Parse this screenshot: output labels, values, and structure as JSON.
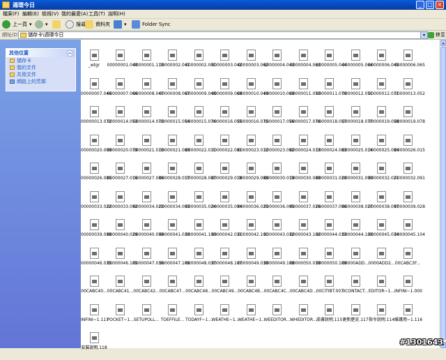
{
  "window": {
    "title": "週環今日"
  },
  "menu": [
    "檔案(F)",
    "編輯(E)",
    "檢視(V)",
    "我的最愛(A)",
    "工具(T)",
    "說明(H)"
  ],
  "toolbar": {
    "back": "上一頁",
    "search": "搜尋",
    "folders": "資料夾",
    "folder_sync": "Folder Sync"
  },
  "address": {
    "label": "網址(D)",
    "value": "儲存卡\\週環今日",
    "go": "移至"
  },
  "tasks": {
    "header": "其他位置",
    "items": [
      "儲存卡",
      "我的文件",
      "共用文件",
      "網路上的芳鄰"
    ]
  },
  "files": [
    "_wtgr",
    "00000001.040",
    "00000001.110",
    "00000002.041",
    "00000002.001",
    "00000003.042",
    "00000003.062",
    "00000004.043",
    "00000004.063",
    "00000005.044",
    "00000005.064",
    "00000006.045",
    "00000006.065",
    "00000007.046",
    "00000007.066",
    "00000008.047",
    "00000008.067",
    "00000009.048",
    "00000009.068",
    "00000010.049",
    "00000010.069",
    "00000011.050",
    "00000011.070",
    "00000012.051",
    "00000012.071",
    "00000013.052",
    "00000013.072",
    "00000014.053",
    "00000014.073",
    "00000015.054",
    "00000015.074",
    "00000016.055",
    "00000016.075",
    "00000017.056",
    "00000017.076",
    "00000018.057",
    "00000018.077",
    "00000019.058",
    "00000019.078",
    "00000020.009",
    "00000020.079",
    "00000021.010",
    "00000021.080",
    "00000022.011",
    "00000022.081",
    "00000023.012",
    "00000023.082",
    "00000024.013",
    "00000024.083",
    "00000025.014",
    "00000025.084",
    "00000026.015",
    "00000026.085",
    "00000027.016",
    "00000027.086",
    "00000028.017",
    "00000028.087",
    "00000029.018",
    "00000029.088",
    "00000030.019",
    "00000030.089",
    "00000031.020",
    "00000031.090",
    "00000032.021",
    "00000032.091",
    "00000033.022",
    "00000033.092",
    "00000034.023",
    "00000034.093",
    "00000035.024",
    "00000035.094",
    "00000036.025",
    "00000036.095",
    "00000037.026",
    "00000037.096",
    "00000038.027",
    "00000038.097",
    "00000039.028",
    "00000039.098",
    "00000040.029",
    "00000040.099",
    "00000041.030",
    "00000041.100",
    "00000042.031",
    "00000042.101",
    "00000043.032",
    "00000043.102",
    "00000044.033",
    "00000044.103",
    "00000045.034",
    "00000045.104",
    "00000046.035",
    "00000046.105",
    "00000047.036",
    "00000047.106",
    "00000048.037",
    "00000048.107",
    "00000049.038",
    "00000049.108",
    "00000050.039",
    "00000050.109",
    "00000ADD...",
    "0000ADD2...",
    "00CABC3F...",
    "00CABC40...",
    "00CABC41...",
    "00CABC42...",
    "00CABC47...",
    "00CABC48...",
    "00CABC49...",
    "00CABC4B...",
    "00CABC4C...",
    "00CABC4D...",
    "00CITIBT.007",
    "0CONTACT...",
    "EDITOR~1...",
    "INFINI~1.000",
    "INFINI~1.111",
    "POCKET~1...",
    "SETUPOLL...",
    "TOEFFILE...",
    "TODAYF~1...",
    "WEATHE~1...",
    "WEATHE~1...",
    "WEEDITOR...",
    "WHEDITOR...",
    "皮膚說明.115",
    "更新歷史.117",
    "指令說明.114",
    "維護用~1.116",
    "安裝說明.118"
  ],
  "watermark": "#1301643"
}
